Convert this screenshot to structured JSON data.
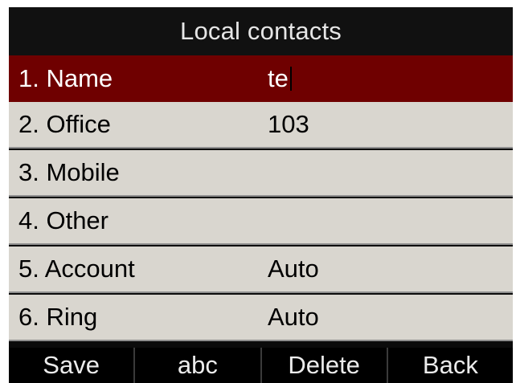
{
  "title": "Local contacts",
  "fields": [
    {
      "label": "1. Name",
      "value": "te",
      "selected": true
    },
    {
      "label": "2. Office",
      "value": "103"
    },
    {
      "label": "3. Mobile",
      "value": ""
    },
    {
      "label": "4. Other",
      "value": ""
    },
    {
      "label": "5. Account",
      "value": "Auto"
    },
    {
      "label": "6. Ring",
      "value": "Auto"
    }
  ],
  "softkeys": {
    "save": "Save",
    "abc": "abc",
    "delete": "Delete",
    "back": "Back"
  },
  "colors": {
    "selected_bg": "#6f0000",
    "row_bg": "#d9d6cf",
    "title_bg": "#111111",
    "softkey_bg": "#000000"
  }
}
